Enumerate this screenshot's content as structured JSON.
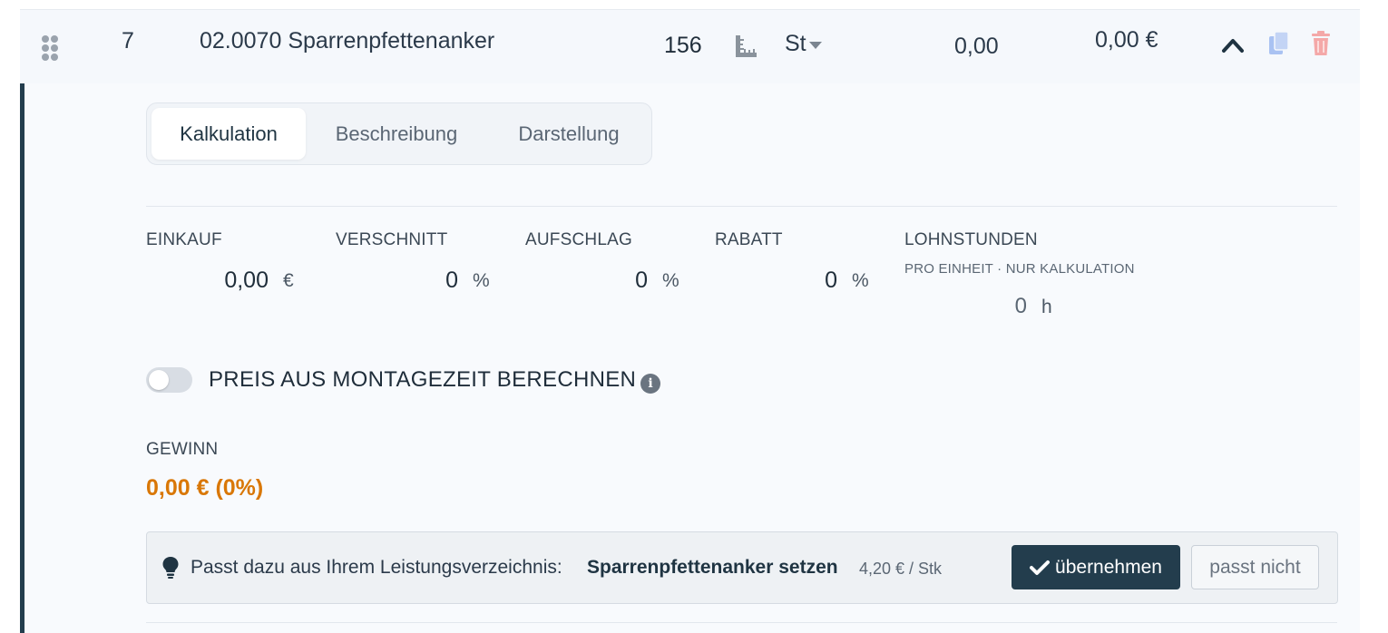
{
  "row": {
    "position": "7",
    "title": "02.0070 Sparrenpfettenanker",
    "quantity": "156",
    "unit": "St",
    "unit_price": "0,00",
    "total_price": "0,00 €"
  },
  "tabs": [
    {
      "label": "Kalkulation",
      "active": true
    },
    {
      "label": "Beschreibung",
      "active": false
    },
    {
      "label": "Darstellung",
      "active": false
    }
  ],
  "fields": {
    "einkauf": {
      "label": "EINKAUF",
      "value": "0,00",
      "unit": "€"
    },
    "verschnitt": {
      "label": "VERSCHNITT",
      "value": "0",
      "unit": "%"
    },
    "aufschlag": {
      "label": "AUFSCHLAG",
      "value": "0",
      "unit": "%"
    },
    "rabatt": {
      "label": "RABATT",
      "value": "0",
      "unit": "%"
    },
    "lohnstunden": {
      "label": "LOHNSTUNDEN",
      "sublabel": "PRO EINHEIT · NUR KALKULATION",
      "value": "0",
      "unit": "h"
    }
  },
  "toggle": {
    "label": "PREIS AUS MONTAGEZEIT BERECHNEN",
    "on": false
  },
  "profit": {
    "label": "GEWINN",
    "value": "0,00 € (0%)"
  },
  "suggestion": {
    "text": "Passt dazu aus Ihrem Leistungsverzeichnis:",
    "item": "Sparrenpfettenanker setzen",
    "price": "4,20 € / Stk",
    "accept_label": "übernehmen",
    "reject_label": "passt nicht"
  },
  "colors": {
    "accent": "#233d4d",
    "profit": "#d97706",
    "copy_icon": "#a9c2f2",
    "delete_icon": "#f4a8a8"
  }
}
